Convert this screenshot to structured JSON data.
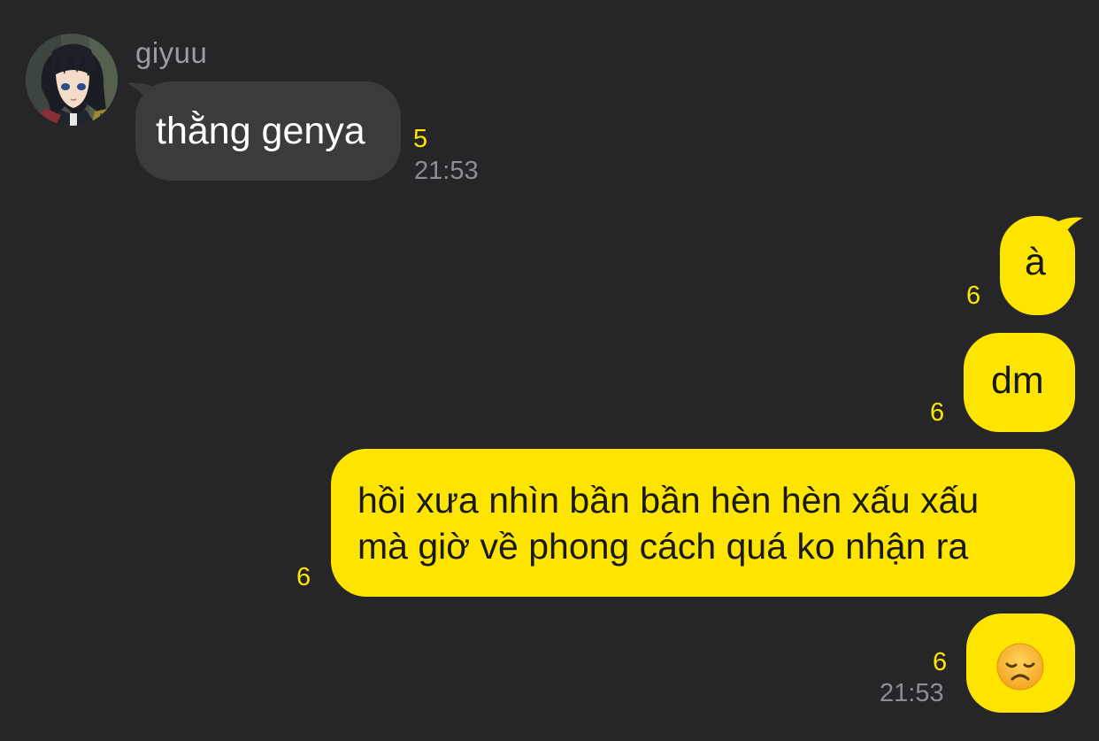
{
  "conversation": {
    "incoming": {
      "sender_name": "giyuu",
      "message": "thằng genya",
      "unread_count": "5",
      "time": "21:53"
    },
    "outgoing": [
      {
        "text": "à",
        "unread_count": "6"
      },
      {
        "text": "dm",
        "unread_count": "6"
      },
      {
        "lines": [
          "hồi xưa nhìn bần bần hèn hèn xấu xấu",
          "mà giờ về phong cách quá ko nhận ra"
        ],
        "unread_count": "6"
      },
      {
        "emoji": "disappointed-face",
        "unread_count": "6",
        "time": "21:53"
      }
    ]
  },
  "colors": {
    "background": "#262628",
    "incoming_bubble": "#3b3b3e",
    "outgoing_bubble": "#fee500",
    "unread": "#fee500",
    "timestamp": "#8e8e92"
  }
}
